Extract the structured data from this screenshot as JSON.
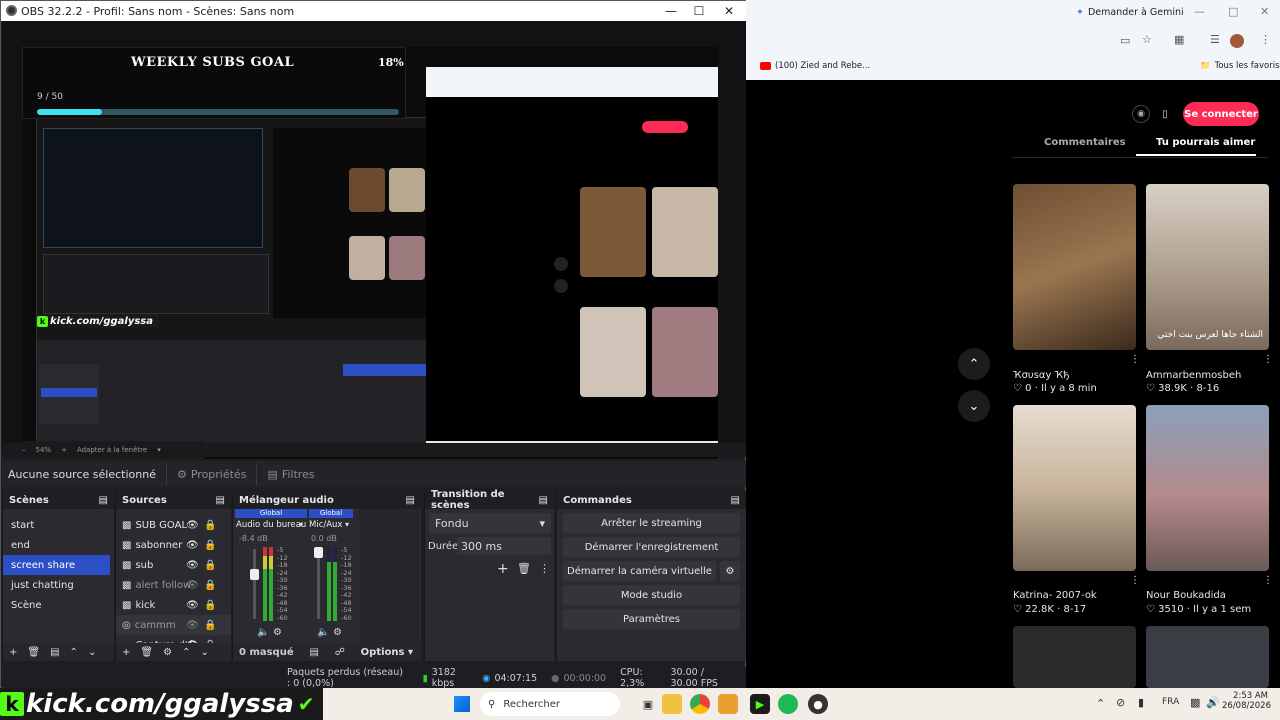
{
  "obs": {
    "title": "OBS 32.2.2 - Profil: Sans nom - Scènes: Sans nom",
    "goal": {
      "title": "WEEKLY SUBS GOAL",
      "percent": "18%",
      "count": "9 / 50",
      "fraction": 0.18
    },
    "kick_banner": "kick.com/ggalyssa",
    "zoom": {
      "label": "54%",
      "fit": "Adapter à la fenêtre"
    },
    "source_bar": {
      "no_source": "Aucune source sélectionné",
      "properties": "Propriétés",
      "filters": "Filtres"
    },
    "scenes": {
      "header": "Scènes",
      "items": [
        "start",
        "end",
        "screen share",
        "just chatting",
        "Scène"
      ],
      "selected": "screen share"
    },
    "sources": {
      "header": "Sources",
      "items": [
        "SUB GOAL",
        "sabonner",
        "sub",
        "alert follow",
        "kick",
        "cammm",
        "Capture d'é"
      ]
    },
    "mixer": {
      "header": "Mélangeur audio",
      "channels": [
        {
          "global": "Global",
          "name": "Audio du bureau",
          "db": "-8.4 dB"
        },
        {
          "global": "Global",
          "name": "Mic/Aux",
          "db": "0.0 dB"
        }
      ],
      "scale": [
        "-5",
        "-12",
        "-18",
        "-24",
        "-30",
        "-36",
        "-42",
        "-48",
        "-54",
        "-60"
      ],
      "masked": "0 masqué",
      "options": "Options"
    },
    "transitions": {
      "header": "Transition de scènes",
      "type": "Fondu",
      "duration_label": "Durée",
      "duration": "300 ms"
    },
    "commands": {
      "header": "Commandes",
      "buttons": [
        "Arrêter le streaming",
        "Démarrer l'enregistrement",
        "Démarrer la caméra virtuelle",
        "Mode studio",
        "Paramètres"
      ]
    },
    "status": {
      "dropped": "Paquets perdus (réseau) : 0 (0,0%)",
      "bitrate": "3182 kbps",
      "stream_time": "04:07:15",
      "rec_time": "00:00:00",
      "cpu": "CPU: 2,3%",
      "fps": "30.00 / 30.00 FPS"
    }
  },
  "browser": {
    "gemini": "Demander à Gemini",
    "bookmark": "(100) Zied and Rebe...",
    "all_favs": "Tous les favoris",
    "connect": "Se connecter",
    "tabs": [
      "Commentaires",
      "Tu pourrais aimer"
    ],
    "cards": [
      {
        "name": "Ҡσυѕαу Ҡђ",
        "likes": "0",
        "meta": "Il y a 8 min"
      },
      {
        "name": "Ammarbenmosbeh",
        "likes": "38.9K",
        "meta": "8-16",
        "overlay": "الشتاء جاها لعرس بنت اختي"
      },
      {
        "name": "Katrina- 2007-ok",
        "likes": "22.8K",
        "meta": "8-17"
      },
      {
        "name": "Nour Boukadida",
        "likes": "3510",
        "meta": "Il y a 1 sem"
      }
    ]
  },
  "taskbar": {
    "search": "Rechercher",
    "lang": "FRA",
    "time": "2:53 AM",
    "date": "26/08/2026"
  }
}
